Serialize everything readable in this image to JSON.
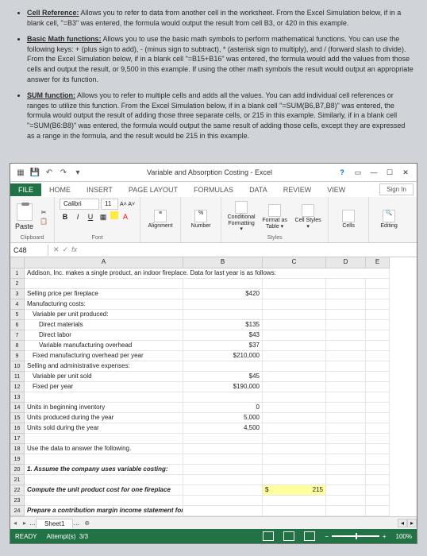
{
  "bullets": [
    {
      "term": "Cell Reference:",
      "text": " Allows you to refer to data from another cell in the worksheet. From the Excel Simulation below, if in a blank cell, \"=B3\" was entered, the formula would output the result from cell B3, or 420 in this example."
    },
    {
      "term": "Basic Math functions:",
      "text": " Allows you to use the basic math symbols to perform mathematical functions. You can use the following keys: + (plus sign to add), - (minus sign to subtract), * (asterisk sign to multiply), and / (forward slash to divide). From the Excel Simulation below, if in a blank cell \"=B15+B16\" was entered, the formula would add the values from those cells and output the result, or 9,500 in this example. If using the other math symbols the result would output an appropriate answer for its function."
    },
    {
      "term": "SUM function:",
      "text": " Allows you to refer to multiple cells and adds all the values. You can add individual cell references or ranges to utilize this function. From the Excel Simulation below, if in a blank cell \"=SUM(B6,B7,B8)\" was entered, the formula would output the result of adding those three separate cells, or 215 in this example. Similarly, if in a blank cell \"=SUM(B6:B8)\" was entered, the formula would output the same result of adding those cells, except they are expressed as a range in the formula, and the result would be 215 in this example."
    }
  ],
  "window": {
    "title": "Variable and Absorption Costing - Excel",
    "signin": "Sign In",
    "help": "?"
  },
  "tabs": [
    "FILE",
    "HOME",
    "INSERT",
    "PAGE LAYOUT",
    "FORMULAS",
    "DATA",
    "REVIEW",
    "VIEW"
  ],
  "ribbon": {
    "clipboard": {
      "paste": "Paste",
      "label": "Clipboard"
    },
    "font": {
      "name": "Calibri",
      "size": "11",
      "aa": "A˄ A˅",
      "b": "B",
      "i": "I",
      "u": "U",
      "label": "Font"
    },
    "alignment": {
      "label": "Alignment"
    },
    "number": {
      "pct": "%",
      "label": "Number"
    },
    "styles": {
      "cond": "Conditional Formatting ▾",
      "fmt": "Format as Table ▾",
      "cell": "Cell Styles ▾",
      "label": "Styles"
    },
    "cells": {
      "label": "Cells"
    },
    "editing": {
      "label": "Editing"
    }
  },
  "formulabar": {
    "namebox": "C48",
    "fx": "fx"
  },
  "cols": [
    "",
    "A",
    "B",
    "C",
    "D",
    "E"
  ],
  "rows": [
    {
      "n": "1",
      "a": "Addison, Inc. makes a single product, an indoor fireplace. Data for last year is as follows:",
      "wide": true
    },
    {
      "n": "2"
    },
    {
      "n": "3",
      "a": "Selling price per fireplace",
      "b": "$420"
    },
    {
      "n": "4",
      "a": "Manufacturing costs:"
    },
    {
      "n": "5",
      "a": "Variable per unit produced:",
      "ind": 1
    },
    {
      "n": "6",
      "a": "Direct materials",
      "ind": 2,
      "b": "$135"
    },
    {
      "n": "7",
      "a": "Direct labor",
      "ind": 2,
      "b": "$43"
    },
    {
      "n": "8",
      "a": "Variable manufacturing overhead",
      "ind": 2,
      "b": "$37"
    },
    {
      "n": "9",
      "a": "Fixed manufacturing overhead per year",
      "ind": 1,
      "b": "$210,000"
    },
    {
      "n": "10",
      "a": "Selling and administrative expenses:"
    },
    {
      "n": "11",
      "a": "Variable per unit sold",
      "ind": 1,
      "b": "$45"
    },
    {
      "n": "12",
      "a": "Fixed per year",
      "ind": 1,
      "b": "$190,000"
    },
    {
      "n": "13"
    },
    {
      "n": "14",
      "a": "Units in beginning inventory",
      "b": "0"
    },
    {
      "n": "15",
      "a": "Units produced during the year",
      "b": "5,000"
    },
    {
      "n": "16",
      "a": "Units sold during the year",
      "b": "4,500"
    },
    {
      "n": "17"
    },
    {
      "n": "18",
      "a": "Use the data to answer the following."
    },
    {
      "n": "19"
    },
    {
      "n": "20",
      "a": "1. Assume the company uses variable costing:",
      "bi": true
    },
    {
      "n": "21"
    },
    {
      "n": "22",
      "a": "Compute the unit product cost for one fireplace",
      "bi": true,
      "c_pre": "$",
      "c": "215",
      "hl": true
    },
    {
      "n": "23"
    },
    {
      "n": "24",
      "a": "Prepare a contribution margin income statement for the year",
      "bi": true
    }
  ],
  "sheet": {
    "name": "Sheet1"
  },
  "status": {
    "ready": "READY",
    "attempts_label": "Attempt(s)",
    "attempts": "3/3",
    "zoom": "100%"
  }
}
